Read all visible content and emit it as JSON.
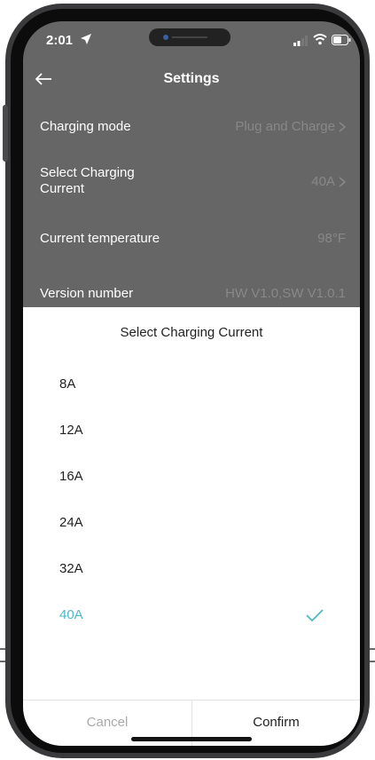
{
  "status_bar": {
    "time": "2:01"
  },
  "header": {
    "title": "Settings"
  },
  "settings": [
    {
      "label": "Charging mode",
      "value": "Plug and Charge"
    },
    {
      "label_lines": [
        "Select Charging",
        "Current"
      ],
      "value": "40A"
    },
    {
      "label": "Current temperature",
      "value": "98°F"
    },
    {
      "label": "Version number",
      "value": "HW V1.0,SW V1.0.1"
    }
  ],
  "sheet": {
    "title": "Select Charging Current",
    "options": [
      "8A",
      "12A",
      "16A",
      "24A",
      "32A",
      "40A"
    ],
    "selected": "40A",
    "cancel_label": "Cancel",
    "confirm_label": "Confirm"
  },
  "colors": {
    "accent": "#4eb9c6",
    "overlay": "#666666"
  }
}
